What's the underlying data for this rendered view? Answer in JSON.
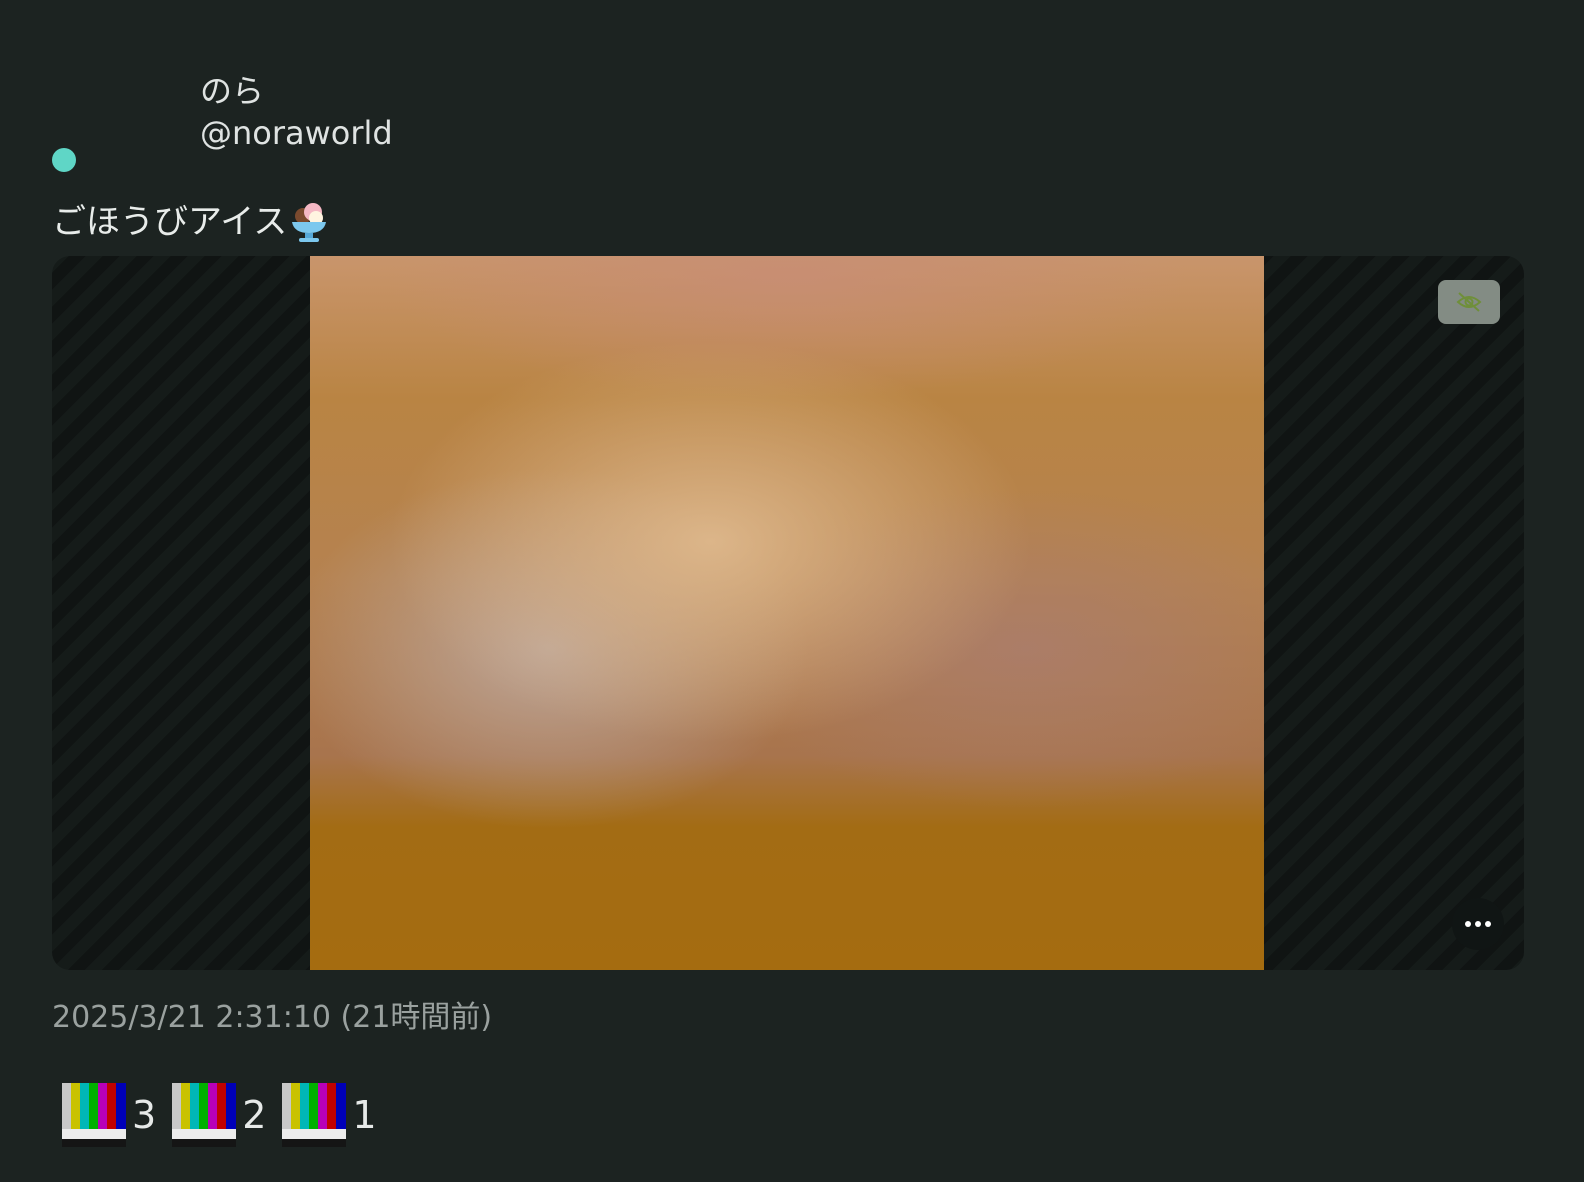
{
  "note": {
    "user": {
      "display_name": "のら",
      "username": "@noraworld",
      "status_color": "#5fd6c6"
    },
    "text": "ごほうびアイス",
    "text_emoji": "ice-cream-icon",
    "media": {
      "sensitive_toggle_icon": "eye-slash-icon",
      "more_icon": "more-horizontal-icon"
    },
    "timestamp": "2025/3/21 2:31:10 (21時間前)",
    "reactions": [
      {
        "emoji": "color-bars-icon",
        "count": "3"
      },
      {
        "emoji": "color-bars-icon",
        "count": "2"
      },
      {
        "emoji": "color-bars-icon",
        "count": "1"
      }
    ]
  },
  "colors": {
    "background": "#1c2321",
    "text": "#e6e9e8",
    "muted_text": "#9aa19f",
    "accent": "#5fd6c6"
  }
}
